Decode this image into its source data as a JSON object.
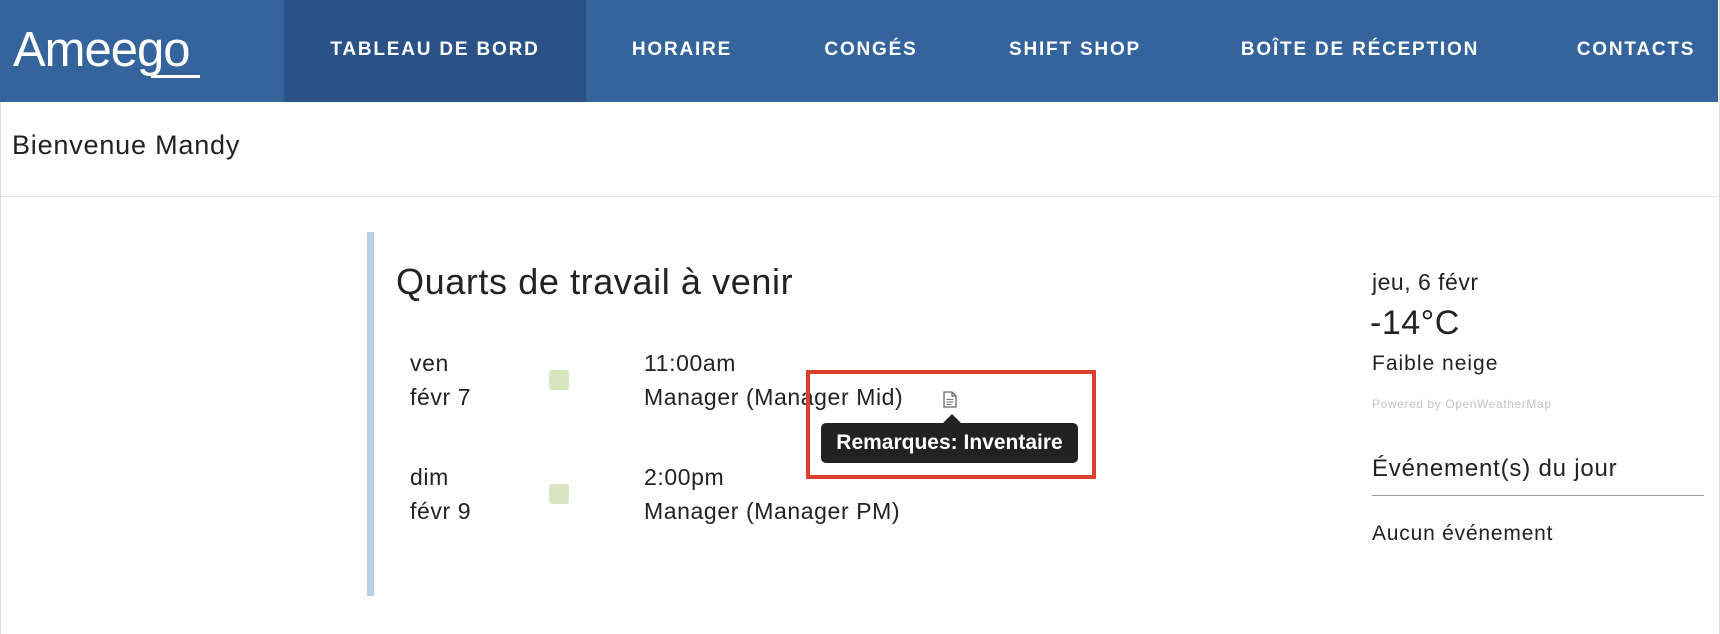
{
  "brand": {
    "logo_text": "Ameego"
  },
  "nav": {
    "items": [
      {
        "label": "TABLEAU DE BORD",
        "active": true
      },
      {
        "label": "HORAIRE",
        "active": false
      },
      {
        "label": "CONGÉS",
        "active": false
      },
      {
        "label": "SHIFT SHOP",
        "active": false
      },
      {
        "label": "BOÎTE DE RÉCEPTION",
        "active": false
      },
      {
        "label": "CONTACTS",
        "active": false
      }
    ]
  },
  "welcome": {
    "text": "Bienvenue Mandy"
  },
  "shifts": {
    "title": "Quarts de travail à venir",
    "items": [
      {
        "day": "ven",
        "date": "févr 7",
        "time": "11:00am",
        "role": "Manager (Manager Mid)",
        "has_note": true,
        "status_color": "#d7e6c0"
      },
      {
        "day": "dim",
        "date": "févr 9",
        "time": "2:00pm",
        "role": "Manager (Manager PM)",
        "has_note": false,
        "status_color": "#d7e6c0"
      }
    ],
    "note_icon": "document-icon"
  },
  "tooltip": {
    "text": "Remarques: Inventaire"
  },
  "weather": {
    "date": "jeu, 6 févr",
    "temperature": "-14°C",
    "condition": "Faible neige",
    "powered_by": "Powered by OpenWeatherMap"
  },
  "events": {
    "title": "Événement(s) du jour",
    "empty_text": "Aucun événement"
  },
  "colors": {
    "navbar": "#34649b",
    "navbar_active": "#2a5287",
    "panel_accent": "#b7d0e8",
    "highlight": "#d9412e"
  }
}
